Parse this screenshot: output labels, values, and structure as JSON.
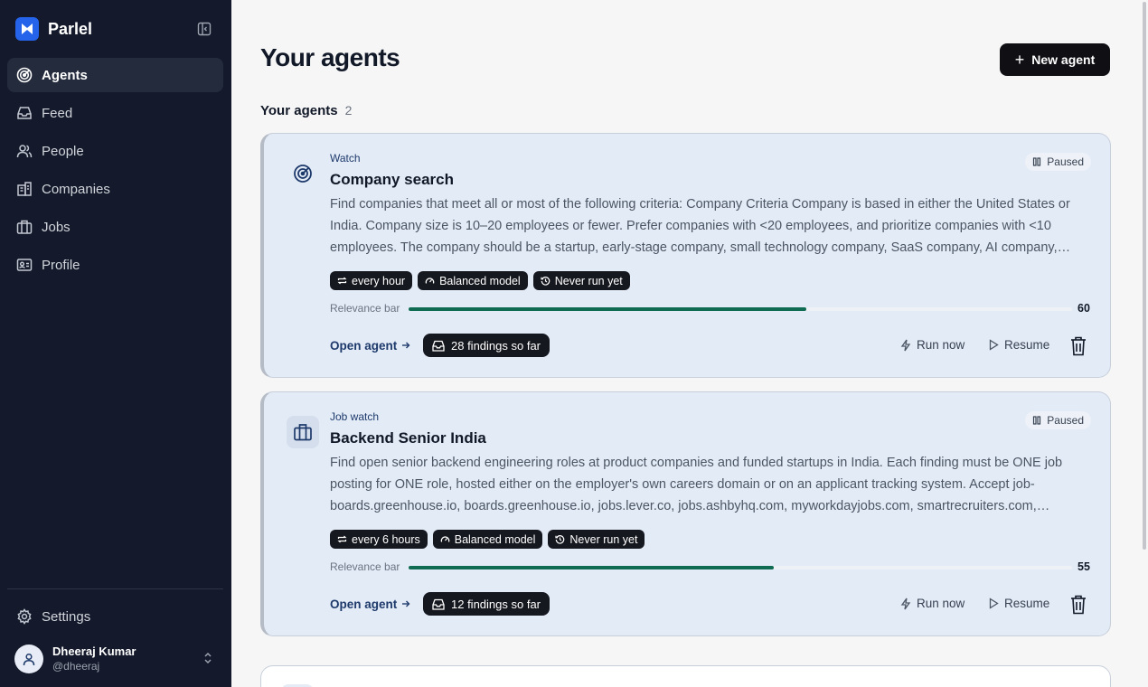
{
  "app": {
    "name": "Parlel",
    "brand_color": "#2563eb"
  },
  "sidebar": {
    "items": [
      {
        "label": "Agents",
        "icon": "radar-icon",
        "active": true
      },
      {
        "label": "Feed",
        "icon": "inbox-icon",
        "active": false
      },
      {
        "label": "People",
        "icon": "users-icon",
        "active": false
      },
      {
        "label": "Companies",
        "icon": "building-icon",
        "active": false
      },
      {
        "label": "Jobs",
        "icon": "briefcase-icon",
        "active": false
      },
      {
        "label": "Profile",
        "icon": "id-card-icon",
        "active": false
      }
    ],
    "settings_label": "Settings",
    "user": {
      "name": "Dheeraj Kumar",
      "handle": "@dheeraj"
    }
  },
  "header": {
    "title": "Your agents",
    "new_agent_label": "New agent"
  },
  "section": {
    "title": "Your agents",
    "count": "2"
  },
  "agents": [
    {
      "kind": "Watch",
      "name": "Company search",
      "icon": "radar-icon",
      "status": "Paused",
      "description": "Find companies that meet all or most of the following criteria: Company Criteria Company is based in either the United States or India. Company size is 10–20 employees or fewer. Prefer companies with <20 employees, and prioritize companies with <10 employees. The company should be a startup, early-stage company, small technology company, SaaS company, AI company,…",
      "chips": [
        "every hour",
        "Balanced model",
        "Never run yet"
      ],
      "relevance_label": "Relevance bar",
      "relevance": 60,
      "relevance_fill_fraction": 0.6,
      "open_label": "Open agent",
      "findings": "28 findings so far",
      "run_label": "Run now",
      "resume_label": "Resume"
    },
    {
      "kind": "Job watch",
      "name": "Backend Senior India",
      "icon": "briefcase-icon",
      "status": "Paused",
      "description": "Find open senior backend engineering roles at product companies and funded startups in India. Each finding must be ONE job posting for ONE role, hosted either on the employer's own careers domain or on an applicant tracking system. Accept job-boards.greenhouse.io, boards.greenhouse.io, jobs.lever.co, jobs.ashbyhq.com, myworkdayjobs.com, smartrecruiters.com,…",
      "chips": [
        "every 6 hours",
        "Balanced model",
        "Never run yet"
      ],
      "relevance_label": "Relevance bar",
      "relevance": 55,
      "relevance_fill_fraction": 0.55,
      "open_label": "Open agent",
      "findings": "12 findings so far",
      "run_label": "Run now",
      "resume_label": "Resume"
    }
  ],
  "colors": {
    "sidebar_bg": "#141a2b",
    "card_bg": "#e3ebf7",
    "relevance_fill": "#0f6b52",
    "accent_text": "#1e3a6b"
  }
}
